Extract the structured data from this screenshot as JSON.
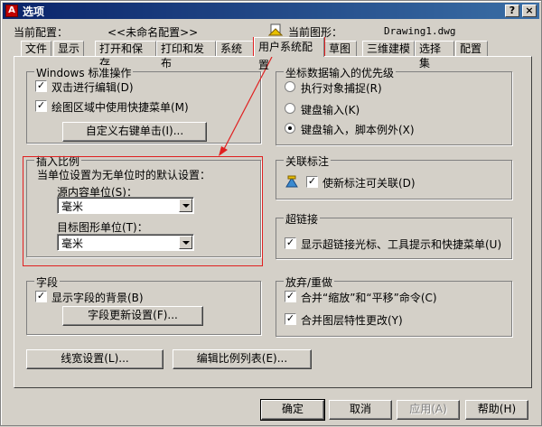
{
  "title": "选项",
  "header": {
    "current_profile_label": "当前配置：",
    "current_profile_value": "<<未命名配置>>",
    "current_drawing_label": "当前图形：",
    "current_drawing_value": "Drawing1.dwg"
  },
  "tabs": [
    "文件",
    "显示",
    "打开和保存",
    "打印和发布",
    "系统",
    "用户系统配置",
    "草图",
    "三维建模",
    "选择集",
    "配置"
  ],
  "windows_ops": {
    "legend": "Windows 标准操作",
    "double_click_edit": "双击进行编辑(D)",
    "shortcut_menu": "绘图区域中使用快捷菜单(M)",
    "custom_right_click": "自定义右键单击(I)..."
  },
  "insert_scale": {
    "legend": "插入比例",
    "desc": "当单位设置为无单位时的默认设置：",
    "source_label": "源内容单位(S)：",
    "source_value": "毫米",
    "target_label": "目标图形单位(T)：",
    "target_value": "毫米"
  },
  "fields": {
    "legend": "字段",
    "show_bg": "显示字段的背景(B)",
    "update_btn": "字段更新设置(F)..."
  },
  "coord_priority": {
    "legend": "坐标数据输入的优先级",
    "opt1": "执行对象捕捉(R)",
    "opt2": "键盘输入(K)",
    "opt3": "键盘输入，脚本例外(X)"
  },
  "assoc_dim": {
    "legend": "关联标注",
    "label": "使新标注可关联(D)"
  },
  "hyperlink": {
    "legend": "超链接",
    "label": "显示超链接光标、工具提示和快捷菜单(U)"
  },
  "undo_redo": {
    "legend": "放弃/重做",
    "zoom_pan": "合并“缩放”和“平移”命令(C)",
    "layer": "合并图层特性更改(Y)"
  },
  "bottom_buttons": {
    "lineweight": "线宽设置(L)...",
    "scale_list": "编辑比例列表(E)..."
  },
  "footer": {
    "ok": "确定",
    "cancel": "取消",
    "apply": "应用(A)",
    "help": "帮助(H)"
  },
  "colors": {
    "highlight": "#e02020",
    "titlebar": "#0a246a"
  }
}
